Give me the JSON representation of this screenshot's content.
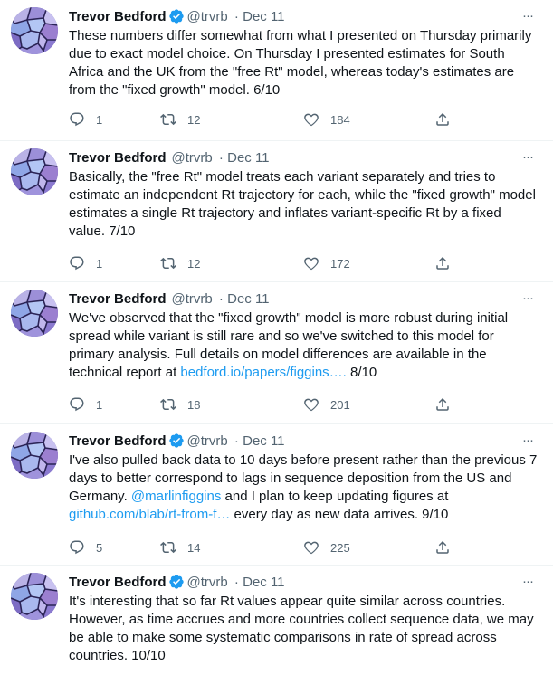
{
  "colors": {
    "link": "#1d9bf0",
    "muted": "#536471",
    "verified": "#1d9bf0"
  },
  "tweets": [
    {
      "author": "Trevor Bedford",
      "handle": "@trvrb",
      "date": "Dec 11",
      "verified": true,
      "text_plain": "These numbers differ somewhat from what I presented on Thursday primarily due to exact model choice. On Thursday I presented estimates for South Africa and the UK from the \"free Rt\" model, whereas today's estimates are from the \"fixed growth\" model. 6/10",
      "replies": "1",
      "retweets": "12",
      "likes": "184"
    },
    {
      "author": "Trevor Bedford",
      "handle": "@trvrb",
      "date": "Dec 11",
      "verified": false,
      "text_plain": "Basically, the \"free Rt\" model treats each variant separately and tries to estimate an independent Rt trajectory for each, while the \"fixed growth\" model estimates a single Rt trajectory and inflates variant-specific Rt by a fixed value. 7/10",
      "replies": "1",
      "retweets": "12",
      "likes": "172"
    },
    {
      "author": "Trevor Bedford",
      "handle": "@trvrb",
      "date": "Dec 11",
      "verified": false,
      "text_pre": "We've observed that the \"fixed growth\" model is more robust during initial spread while variant is still rare and so we've switched to this model for primary analysis. Full details on model differences are available in the technical report at ",
      "link": "bedford.io/papers/figgins….",
      "text_post": " 8/10",
      "replies": "1",
      "retweets": "18",
      "likes": "201"
    },
    {
      "author": "Trevor Bedford",
      "handle": "@trvrb",
      "date": "Dec 11",
      "verified": true,
      "text_pre": "I've also pulled back data to 10 days before present rather than the previous 7 days to better correspond to lags in sequence deposition from the US and Germany. ",
      "mention": "@marlinfiggins",
      "text_mid": " and I plan to keep updating figures at ",
      "link": "github.com/blab/rt-from-f…",
      "text_post": " every day as new data arrives. 9/10",
      "replies": "5",
      "retweets": "14",
      "likes": "225"
    },
    {
      "author": "Trevor Bedford",
      "handle": "@trvrb",
      "date": "Dec 11",
      "verified": true,
      "text_plain": "It's interesting that so far Rt values appear quite similar across countries. However, as time accrues and more countries collect sequence data, we may be able to make some systematic comparisons in rate of spread across countries. 10/10"
    }
  ]
}
